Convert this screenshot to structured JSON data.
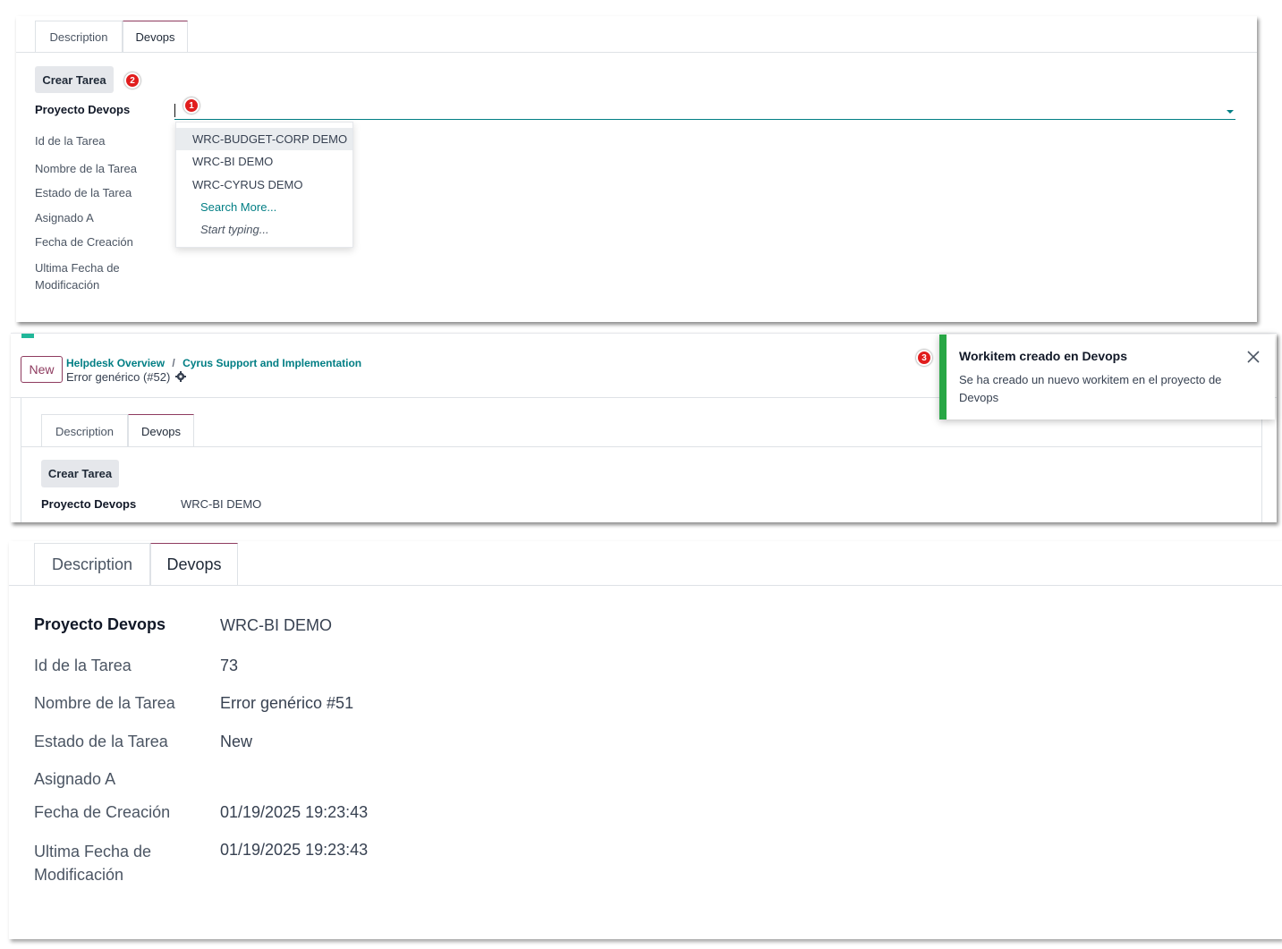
{
  "panel1": {
    "tabs": [
      "Description",
      "Devops"
    ],
    "crear_tarea": "Crear Tarea",
    "badge_btn": "2",
    "badge_input": "1",
    "labels": {
      "proyecto": "Proyecto Devops",
      "id": "Id de la Tarea",
      "nombre": "Nombre de la Tarea",
      "estado": "Estado de la Tarea",
      "asignado": "Asignado A",
      "fecha_creacion": "Fecha de Creación",
      "ultima_fecha_1": "Ultima Fecha de",
      "ultima_fecha_2": "Modificación"
    },
    "dropdown": {
      "items": [
        "WRC-BUDGET-CORP DEMO",
        "WRC-BI DEMO",
        "WRC-CYRUS DEMO"
      ],
      "search_more": "Search More...",
      "start_typing": "Start typing..."
    }
  },
  "panel2": {
    "new_button": "New",
    "breadcrumb": [
      "Helpdesk Overview",
      "Cyrus Support and Implementation"
    ],
    "breadcrumb_sep": "/",
    "record": "Error genérico (#52)",
    "tabs": [
      "Description",
      "Devops"
    ],
    "crear_tarea": "Crear Tarea",
    "proyecto_label": "Proyecto Devops",
    "proyecto_value": "WRC-BI DEMO",
    "toast": {
      "badge": "3",
      "title": "Workitem creado en Devops",
      "message": "Se ha creado un nuevo workitem en el proyecto de Devops"
    }
  },
  "panel3": {
    "tabs": [
      "Description",
      "Devops"
    ],
    "fields": [
      {
        "label": "Proyecto Devops",
        "value": "WRC-BI DEMO"
      },
      {
        "label": "Id de la Tarea",
        "value": "73"
      },
      {
        "label": "Nombre de la Tarea",
        "value": "Error genérico #51"
      },
      {
        "label": "Estado de la Tarea",
        "value": "New"
      },
      {
        "label": "Asignado A",
        "value": ""
      },
      {
        "label": "Fecha de Creación",
        "value": "01/19/2025 19:23:43"
      },
      {
        "label": "Ultima Fecha de Modificación",
        "value": "01/19/2025 19:23:43"
      }
    ],
    "ultima_1": "Ultima Fecha de",
    "ultima_2": "Modificación"
  },
  "colors": {
    "accent": "#017e84",
    "active_tab": "#8e3b5f",
    "success": "#28a745",
    "badge": "#e11d1d"
  }
}
